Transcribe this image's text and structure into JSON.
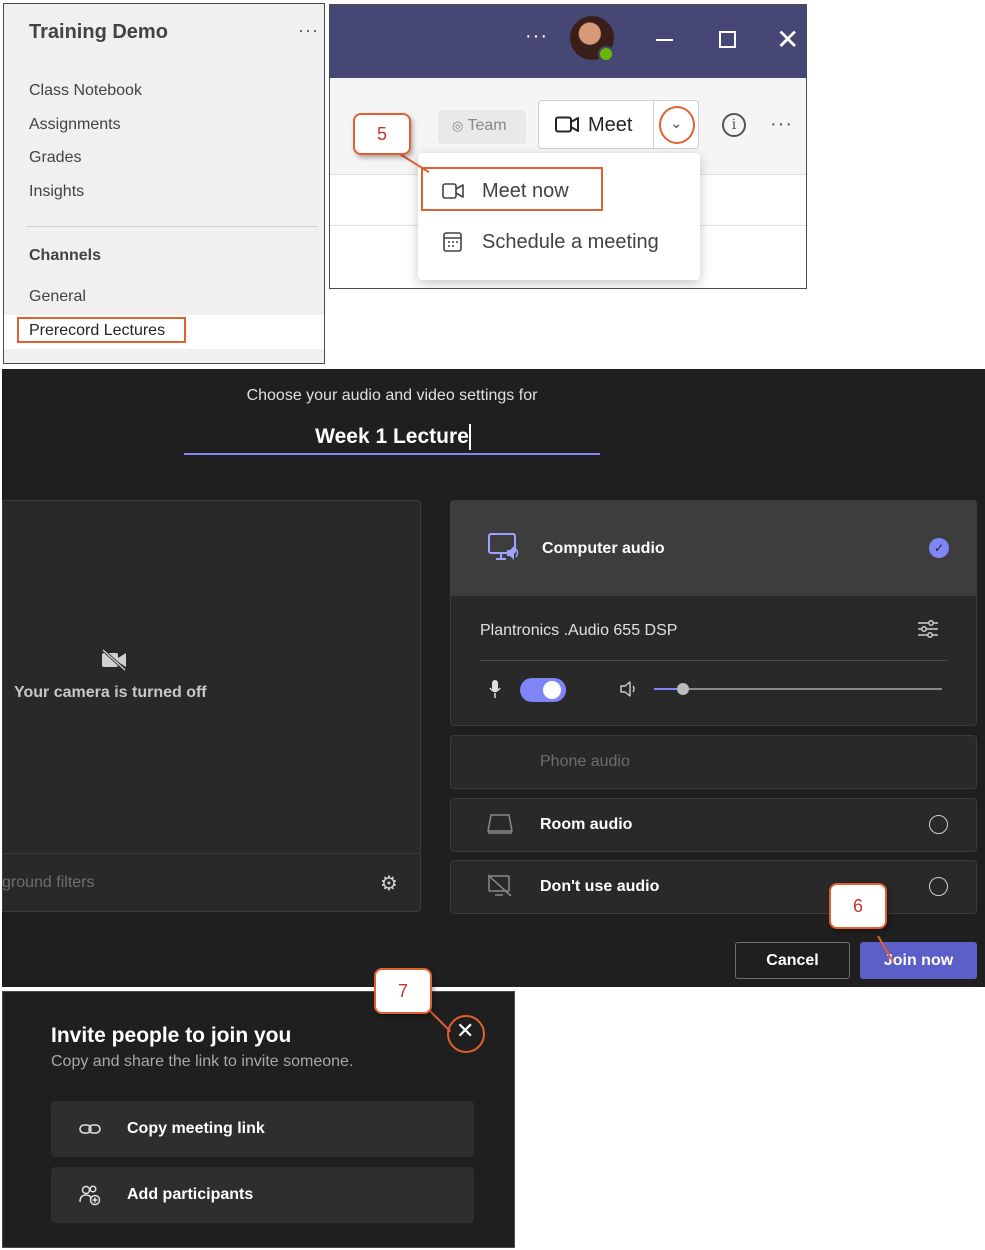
{
  "sidebar": {
    "team_name": "Training Demo",
    "more": "···",
    "items": [
      "Class Notebook",
      "Assignments",
      "Grades",
      "Insights"
    ],
    "channels_heading": "Channels",
    "channels": [
      "General",
      "Prerecord Lectures"
    ]
  },
  "meet_panel": {
    "window_more": "···",
    "team_chip": "Team",
    "meet_label": "Meet",
    "info": "i",
    "toolbar_more": "···",
    "dropdown": {
      "meet_now": "Meet now",
      "schedule": "Schedule a meeting"
    }
  },
  "callouts": {
    "step5": "5",
    "step6": "6",
    "step7": "7"
  },
  "prejoin": {
    "heading": "Choose your audio and video settings for",
    "meeting_title": "Week 1 Lecture",
    "camera_off": "Your camera is turned off",
    "background_filters": "ground filters",
    "audio_options": {
      "computer_audio": "Computer audio",
      "device": "Plantronics .Audio 655 DSP",
      "mic_on": true,
      "volume_fraction": 0.1,
      "phone_audio": "Phone audio",
      "room_audio": "Room audio",
      "no_audio": "Don't use audio"
    },
    "cancel": "Cancel",
    "join": "Join now"
  },
  "invite": {
    "title": "Invite people to join you",
    "subtitle": "Copy and share the link to invite someone.",
    "copy_link": "Copy meeting link",
    "add_participants": "Add participants"
  },
  "colors": {
    "accent": "#7f85f5",
    "join_button": "#5b5fc7",
    "callout_border": "#e06030",
    "titlebar": "#464775",
    "dark_bg": "#1f1f1f"
  }
}
